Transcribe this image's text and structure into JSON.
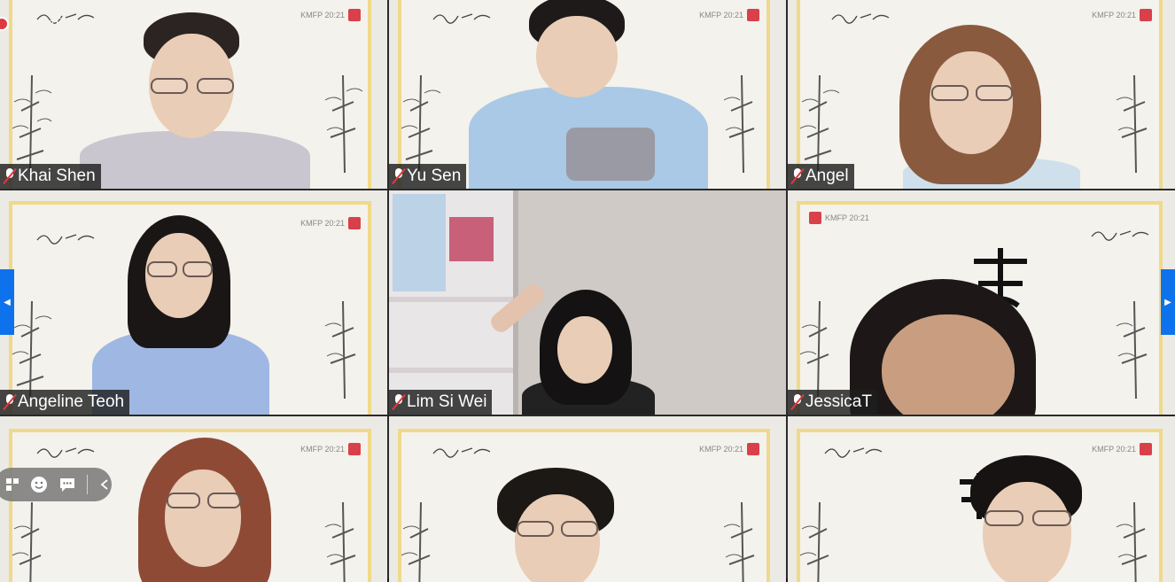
{
  "recording": {
    "label": "Recording"
  },
  "participants": [
    {
      "name": "Khai Shen",
      "muted": true
    },
    {
      "name": "Yu Sen",
      "muted": true
    },
    {
      "name": "Angel",
      "muted": true
    },
    {
      "name": "Angeline Teoh",
      "muted": true
    },
    {
      "name": "Lim Si Wei",
      "muted": true
    },
    {
      "name": "JessicaT",
      "muted": true
    },
    {
      "name": "",
      "muted": false
    },
    {
      "name": "",
      "muted": false
    },
    {
      "name": "",
      "muted": false
    }
  ],
  "background": {
    "stamp_text": "KMFP 20:21",
    "accent_frame": "#f0d98a",
    "seal_color": "#d9404a"
  },
  "colors": {
    "nav_arrow": "#0e72ed",
    "mute_slash": "#e0383e"
  },
  "reaction_toolbar": {
    "icons": [
      "grid-layout-icon",
      "emoji-icon",
      "chat-icon",
      "collapse-chevron-icon"
    ]
  }
}
